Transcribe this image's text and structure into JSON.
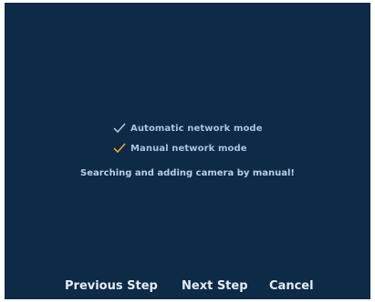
{
  "options": [
    {
      "label": "Automatic network mode",
      "check_color": "#a9c4e2"
    },
    {
      "label": "Manual network mode",
      "check_color": "#f2a030"
    }
  ],
  "status": "Searching and adding camera by manual!",
  "footer": {
    "previous_label": "Previous Step",
    "next_label": "Next Step",
    "cancel_label": "Cancel"
  },
  "colors": {
    "background": "#0d2a46",
    "text": "#a9c4e2",
    "button_text": "#e4ecf5"
  }
}
